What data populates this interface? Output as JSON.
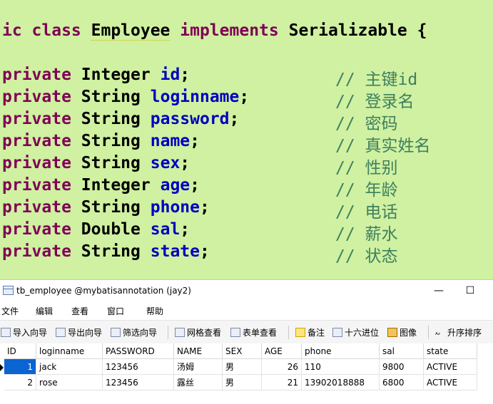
{
  "code": {
    "class_decl": {
      "prefix": "ic class ",
      "class_name": "Employee",
      "implements_kw": "implements",
      "interface_name": "Serializable",
      "brace": "{"
    },
    "fields": [
      {
        "modifier": "private",
        "type": "Integer",
        "name": "id",
        "comment": "// 主键id"
      },
      {
        "modifier": "private",
        "type": "String",
        "name": "loginname",
        "comment": "// 登录名"
      },
      {
        "modifier": "private",
        "type": "String",
        "name": "password",
        "comment": "// 密码"
      },
      {
        "modifier": "private",
        "type": "String",
        "name": "name",
        "comment": "// 真实姓名"
      },
      {
        "modifier": "private",
        "type": "String",
        "name": "sex",
        "comment": "// 性别"
      },
      {
        "modifier": "private",
        "type": "Integer",
        "name": "age",
        "comment": "// 年龄"
      },
      {
        "modifier": "private",
        "type": "String",
        "name": "phone",
        "comment": "// 电话"
      },
      {
        "modifier": "private",
        "type": "Double",
        "name": "sal",
        "comment": "// 薪水"
      },
      {
        "modifier": "private",
        "type": "String",
        "name": "state",
        "comment": "// 状态"
      }
    ]
  },
  "window": {
    "title": "tb_employee @mybatisannotation (jay2)",
    "minimize_glyph": "—",
    "maximize_glyph": "☐"
  },
  "menu": [
    "文件",
    "编辑",
    "查看",
    "窗口",
    "帮助"
  ],
  "toolbar": {
    "import_wizard": "导入向导",
    "export_wizard": "导出向导",
    "filter_wizard": "筛选向导",
    "grid_view": "网格查看",
    "form_view": "表单查看",
    "memo": "备注",
    "hex": "十六进位",
    "image": "图像",
    "sort_asc": "升序排序"
  },
  "table": {
    "columns": [
      "ID",
      "loginname",
      "PASSWORD",
      "NAME",
      "SEX",
      "AGE",
      "phone",
      "sal",
      "state"
    ],
    "rows": [
      [
        "1",
        "jack",
        "123456",
        "汤姆",
        "男",
        "26",
        "110",
        "9800",
        "ACTIVE"
      ],
      [
        "2",
        "rose",
        "123456",
        "露丝",
        "男",
        "21",
        "13902018888",
        "6800",
        "ACTIVE"
      ]
    ]
  },
  "colors": {
    "editor_bg": "#cff1a1",
    "keyword": "#7f0055",
    "field": "#0000c0",
    "comment": "#3f7f5f",
    "selection": "#0a64d2"
  }
}
